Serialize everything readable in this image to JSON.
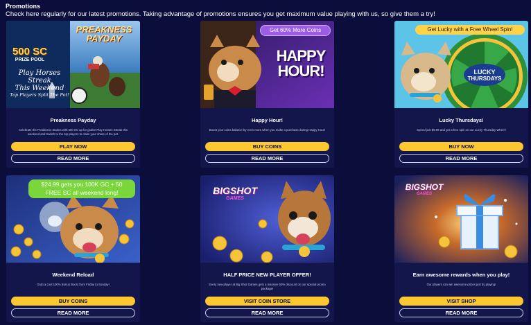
{
  "header": {
    "title": "Promotions",
    "intro": "Check here regularly for our latest promotions. Taking advantage of promotions ensures you get maximum value playing with us, so give them a try!"
  },
  "cards": [
    {
      "title": "Preakness Payday",
      "description": "Celebrate the Preakness Stakes with 500 SC up for grabs! Play Horses Streak this weekend and Switch to the top players to claim your share of the pot.",
      "primary_button": "PLAY NOW",
      "secondary_button": "READ MORE",
      "art": {
        "sc_amount": "500 SC",
        "prize_pool": "PRIZE POOL",
        "logo_line1": "PREAKNESS",
        "logo_line2": "PAYDAY",
        "line1": "Play Horses Streak",
        "line2": "This Weekend",
        "line3": "Top Players Split The Pot!"
      }
    },
    {
      "title": "Happy Hour!",
      "description": "Boost your coins balance by even more when you make a purchase during Happy Hour!",
      "primary_button": "BUY COINS",
      "secondary_button": "READ MORE",
      "art": {
        "badge": "Get 60% More Coins",
        "line1": "HAPPY",
        "line2": "HOUR!"
      }
    },
    {
      "title": "Lucky Thursdays!",
      "description": "Spend just $9.99 and get a free spin on our Lucky Thursday Wheel!",
      "primary_button": "BUY NOW",
      "secondary_button": "READ MORE",
      "art": {
        "badge": "Get Lucky with a Free Wheel Spin!",
        "wheel_line1": "LUCKY",
        "wheel_line2": "THURSDAYS"
      }
    },
    {
      "title": "Weekend Reload",
      "description": "Grab a cool 100% Bonus Boost from Friday to Sunday!",
      "primary_button": "BUY COINS",
      "secondary_button": "READ MORE",
      "art": {
        "badge_line1": "$24.99 gets you 100K GC + 50",
        "badge_line2": "FREE SC all weekend long!"
      }
    },
    {
      "title": "HALF PRICE NEW PLAYER OFFER!",
      "description": "Every new player at Big Shot Games gets a massive 50% discount on our special promo package!",
      "primary_button": "VISIT COIN STORE",
      "secondary_button": "READ MORE",
      "art": {
        "logo_line1": "BIGSHOT",
        "logo_line2": "GAMES"
      }
    },
    {
      "title": "Earn awesome rewards when you play!",
      "description": "Our players can win awesome prizes just by playing!",
      "primary_button": "VISIT SHOP",
      "secondary_button": "READ MORE",
      "art": {
        "logo_line1": "BIGSHOT",
        "logo_line2": "GAMES"
      }
    }
  ],
  "colors": {
    "background": "#0b0d3a",
    "card": "#13164a",
    "primary_button": "#fdc72f",
    "badge_green": "#7bd63b",
    "badge_purple": "#9b5de5"
  }
}
